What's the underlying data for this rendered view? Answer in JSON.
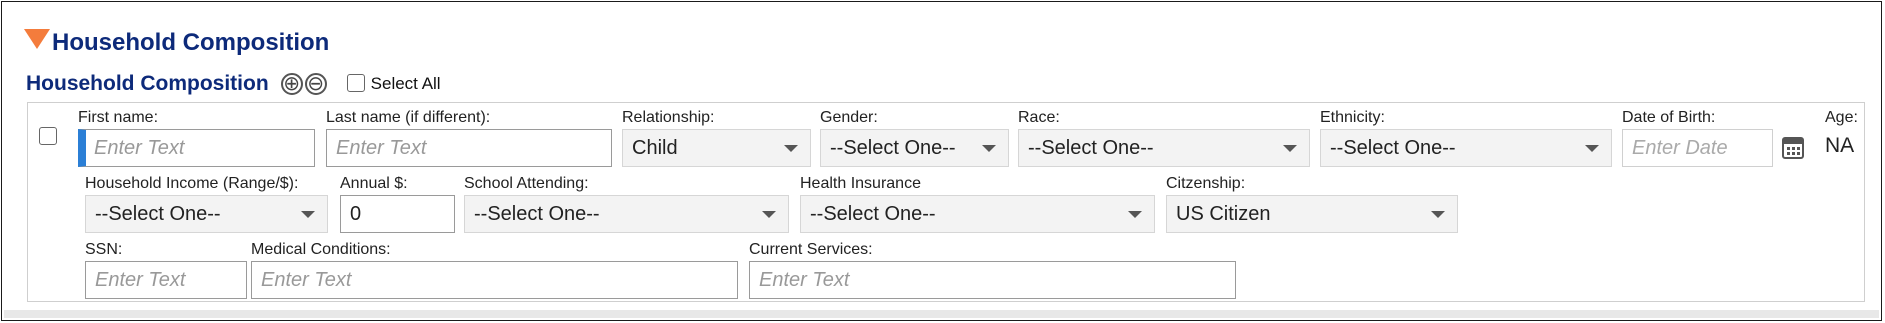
{
  "section": {
    "title": "Household Composition",
    "subtitle": "Household Composition",
    "add_icon": "plus-circle-icon",
    "remove_icon": "minus-circle-icon",
    "add_symbol": "⊕",
    "remove_symbol": "⊖",
    "select_all_label": "Select All",
    "accent_color": "#f47c3c",
    "title_color": "#0d2a7a"
  },
  "member": {
    "first_name": {
      "label": "First name:",
      "value": "",
      "placeholder": "Enter Text"
    },
    "last_name": {
      "label": "Last name (if different):",
      "value": "",
      "placeholder": "Enter Text"
    },
    "relationship": {
      "label": "Relationship:",
      "selected": "Child"
    },
    "gender": {
      "label": "Gender:",
      "selected": "--Select One--"
    },
    "race": {
      "label": "Race:",
      "selected": "--Select One--"
    },
    "ethnicity": {
      "label": "Ethnicity:",
      "selected": "--Select One--"
    },
    "dob": {
      "label": "Date of Birth:",
      "placeholder": "Enter Date",
      "icon": "calendar-icon"
    },
    "age": {
      "label": "Age:",
      "value": "NA"
    },
    "household_income": {
      "label": "Household Income (Range/$):",
      "selected": "--Select One--"
    },
    "annual": {
      "label": "Annual $:",
      "value": "0"
    },
    "school": {
      "label": "School Attending:",
      "selected": "--Select One--"
    },
    "health_insurance": {
      "label": "Health Insurance",
      "selected": "--Select One--"
    },
    "citizenship": {
      "label": "Citzenship:",
      "selected": "US Citizen"
    },
    "ssn": {
      "label": "SSN:",
      "placeholder": "Enter Text"
    },
    "medical": {
      "label": "Medical Conditions:",
      "placeholder": "Enter Text"
    },
    "services": {
      "label": "Current Services:",
      "placeholder": "Enter Text"
    }
  }
}
